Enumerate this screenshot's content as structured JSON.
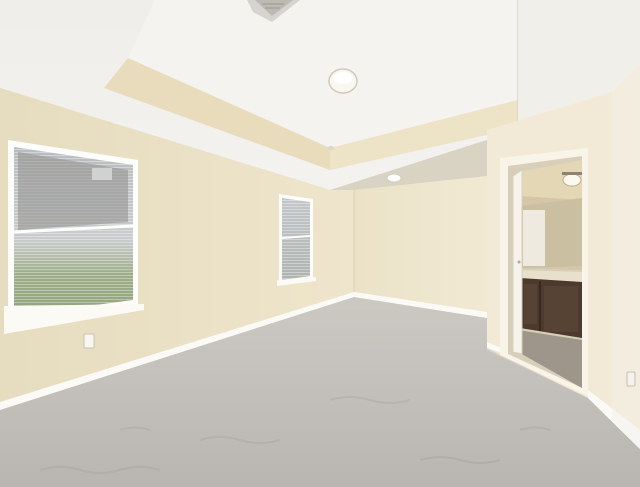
{
  "scene": {
    "subject": "empty-bedroom-interior",
    "features": [
      "tray-ceiling",
      "ceiling-light",
      "air-vent",
      "two-windows-with-blinds",
      "carpet-floor",
      "open-door-to-bathroom",
      "bathroom-vanity",
      "baseboards",
      "electrical-outlet"
    ]
  },
  "colors": {
    "wall_left": "#ece2c6",
    "wall_back": "#efe6cd",
    "wall_right": "#f3ecd9",
    "ceiling": "#f2f0eb",
    "tray_face": "#e9dfc2",
    "carpet": "#c4c0bb",
    "baseboard": "#fbfaf6",
    "window_frame": "#fdfdfb",
    "vanity": "#4b3a2d"
  }
}
